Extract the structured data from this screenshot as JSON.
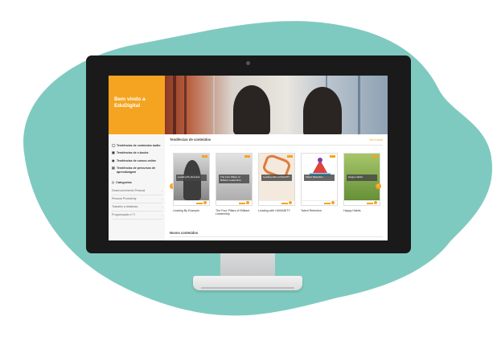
{
  "colors": {
    "teal": "#7fcac0",
    "accent": "#f5a421",
    "bezel": "#1a1a1a"
  },
  "welcome": {
    "line1": "Bem vindo a",
    "line2": "EduDigital"
  },
  "sidebar": {
    "items": [
      {
        "icon": "headphones-icon",
        "label": "Tendências de conteúdos áudio"
      },
      {
        "icon": "book-icon",
        "label": "Tendências de e-books"
      },
      {
        "icon": "location-icon",
        "label": "Tendências de cursos online"
      },
      {
        "icon": "learning-path-icon",
        "label": "Tendências de percursos de aprendizagem"
      }
    ],
    "categories_title": "Categorias",
    "categories": [
      "Desenvolvimento Pessoal",
      "Pessoal Produtivity",
      "Trabalho à distância",
      "Programação e TI"
    ]
  },
  "main": {
    "section_title": "Tendências de conteúdos",
    "see_all": "Ver todos",
    "new_section_title": "Novos conteúdos",
    "cards": [
      {
        "overlay": "Leading By Example",
        "title": "Leading By Example",
        "bg": "#8c8c8c"
      },
      {
        "overlay": "The Four Pillars of Brilliant Leadership",
        "title": "The Four Pillars of Brilliant Leadership",
        "bg": "#c9c9c9"
      },
      {
        "overlay": "Leading with HUMANITY",
        "title": "Leading with HUMANITY",
        "bg": "#f3e9dd"
      },
      {
        "overlay": "Talent Retention",
        "title": "Talent Retention",
        "bg": "#ffffff"
      },
      {
        "overlay": "Happy Habits",
        "title": "Happy Habits",
        "bg": "#7aa84a"
      }
    ]
  }
}
